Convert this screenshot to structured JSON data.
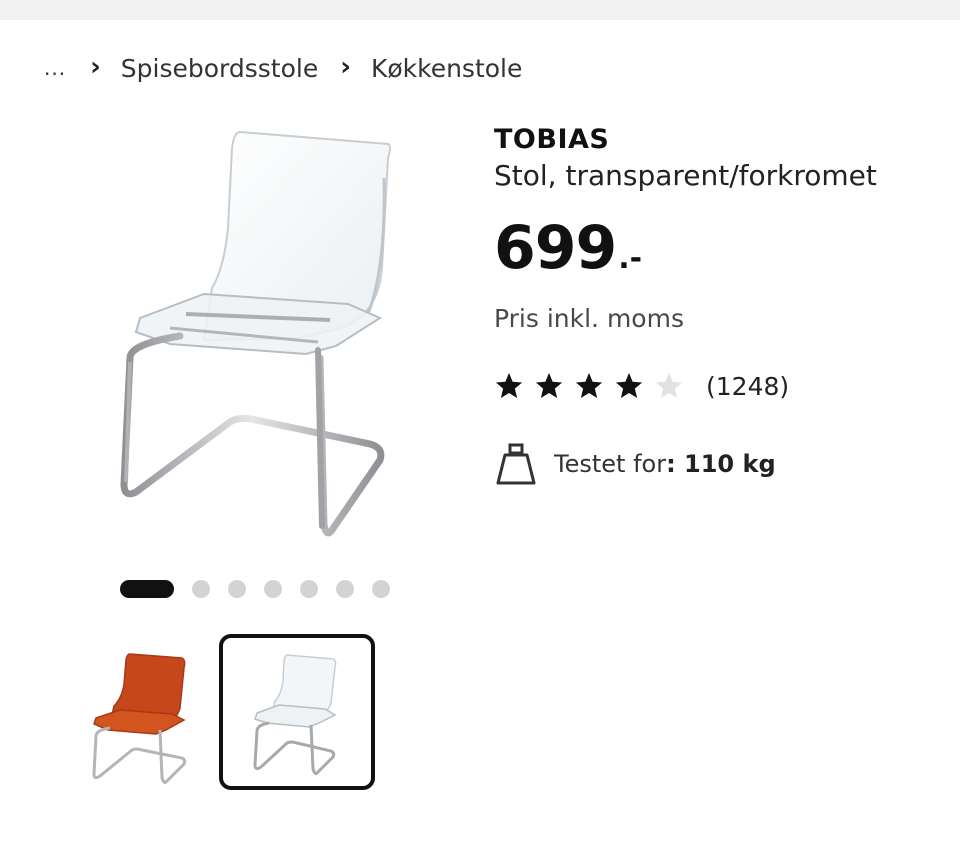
{
  "breadcrumb": {
    "ellipsis": "...",
    "separator": "›",
    "items": [
      {
        "label": "Spisebordsstole"
      },
      {
        "label": "Køkkenstole"
      }
    ]
  },
  "product": {
    "name": "TOBIAS",
    "description": "Stol, transparent/forkromet",
    "price": "699",
    "price_suffix": ".-",
    "price_note": "Pris inkl. moms",
    "rating": {
      "value": 4,
      "max": 5,
      "count": "(1248)",
      "filled_color": "#111111",
      "empty_color": "#e2e2e2"
    },
    "tested": {
      "label": "Testet for",
      "value": ": 110 kg",
      "icon": "weight-icon"
    }
  },
  "gallery": {
    "total_images": 7,
    "active_index": 0,
    "thumbnails": [
      {
        "name": "orange-chair",
        "color": "#c6471c",
        "selected": false
      },
      {
        "name": "transparent-chair",
        "color": "#e8eef2",
        "selected": true
      }
    ]
  },
  "colors": {
    "text": "#111111",
    "dot_inactive": "#d3d3d3",
    "dot_active": "#111111",
    "chrome": "#a7a9ad"
  }
}
